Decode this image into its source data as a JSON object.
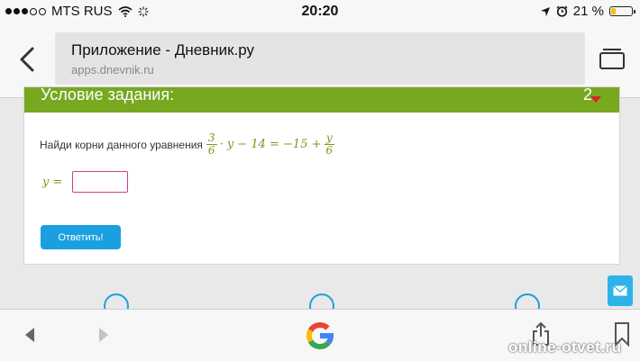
{
  "status_bar": {
    "carrier": "MTS RUS",
    "time": "20:20",
    "battery": "21 %",
    "battery_level": 0.21
  },
  "app_header": {
    "title": "Приложение - Дневник.ру",
    "url": "apps.dnevnik.ru"
  },
  "task_card": {
    "header": "Условие задания:",
    "count": "2",
    "question": "Найди корни данного уравнения",
    "equation": {
      "frac1_num": "3",
      "frac1_den": "6",
      "middle": "· y − 14 = −15 +",
      "frac2_num": "y",
      "frac2_den": "6"
    },
    "answer_label": "y =",
    "answer_value": "",
    "submit_label": "Ответить!"
  },
  "watermark": "online-otvet.ru",
  "colors": {
    "header_green": "#78a820",
    "button_blue": "#1aa0e0",
    "input_border": "#d23a8a"
  }
}
